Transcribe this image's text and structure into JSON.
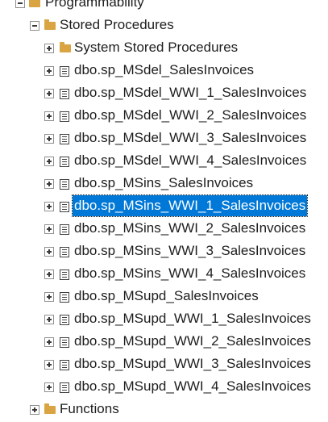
{
  "tree": {
    "programmability": {
      "label": "Programmability"
    },
    "stored_procedures": {
      "label": "Stored Procedures"
    },
    "system_stored_procedures": {
      "label": "System Stored Procedures"
    },
    "procedures": [
      {
        "label": "dbo.sp_MSdel_SalesInvoices"
      },
      {
        "label": "dbo.sp_MSdel_WWI_1_SalesInvoices"
      },
      {
        "label": "dbo.sp_MSdel_WWI_2_SalesInvoices"
      },
      {
        "label": "dbo.sp_MSdel_WWI_3_SalesInvoices"
      },
      {
        "label": "dbo.sp_MSdel_WWI_4_SalesInvoices"
      },
      {
        "label": "dbo.sp_MSins_SalesInvoices"
      },
      {
        "label": "dbo.sp_MSins_WWI_1_SalesInvoices",
        "selected": true
      },
      {
        "label": "dbo.sp_MSins_WWI_2_SalesInvoices"
      },
      {
        "label": "dbo.sp_MSins_WWI_3_SalesInvoices"
      },
      {
        "label": "dbo.sp_MSins_WWI_4_SalesInvoices"
      },
      {
        "label": "dbo.sp_MSupd_SalesInvoices"
      },
      {
        "label": "dbo.sp_MSupd_WWI_1_SalesInvoices"
      },
      {
        "label": "dbo.sp_MSupd_WWI_2_SalesInvoices"
      },
      {
        "label": "dbo.sp_MSupd_WWI_3_SalesInvoices"
      },
      {
        "label": "dbo.sp_MSupd_WWI_4_SalesInvoices"
      }
    ],
    "functions": {
      "label": "Functions"
    }
  },
  "colors": {
    "selection": "#0078d7",
    "folder": "#d9a441"
  },
  "icons": {
    "folder": "folder-icon",
    "procedure": "stored-procedure-icon",
    "expand": "expand-plus-icon",
    "collapse": "collapse-minus-icon"
  }
}
